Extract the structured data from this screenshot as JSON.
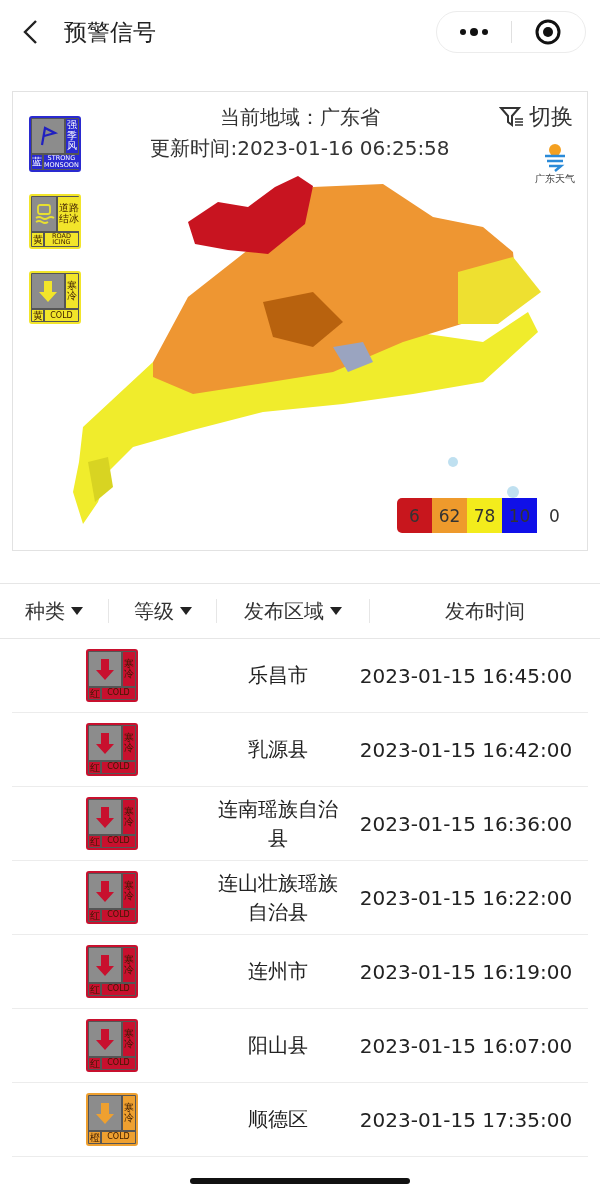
{
  "nav": {
    "title": "预警信号"
  },
  "card": {
    "region": "当前地域：广东省",
    "updated": "更新时间:2023-01-16 06:25:58",
    "switch": "切换",
    "logo": "广东天气",
    "signals": [
      {
        "kind": "monsoon",
        "title": "强季风",
        "level": "蓝",
        "english": "STRONG MONSOON",
        "color": "#2a2ad0"
      },
      {
        "kind": "icing",
        "title": "道路结冰",
        "level": "黄",
        "english": "ROAD ICING",
        "color": "#f2e52a"
      },
      {
        "kind": "cold",
        "title": "寒冷",
        "level": "黄",
        "english": "COLD",
        "color": "#f2e52a"
      }
    ],
    "legend": [
      {
        "count": "6",
        "color": "#c8161d"
      },
      {
        "count": "62",
        "color": "#ee9a2c"
      },
      {
        "count": "78",
        "color": "#f3ec1c"
      },
      {
        "count": "10",
        "color": "#1010e8"
      },
      {
        "count": "0",
        "color": "#ffffff"
      }
    ]
  },
  "table": {
    "columns": [
      {
        "label": "种类",
        "kind": "filter"
      },
      {
        "label": "等级",
        "kind": "filter"
      },
      {
        "label": "发布区域",
        "kind": "filter"
      },
      {
        "label": "发布时间",
        "kind": "plain"
      }
    ],
    "rows": [
      {
        "signal": {
          "kind": "cold",
          "title": "寒冷",
          "level": "红",
          "english": "COLD",
          "color": "#c8102e"
        },
        "area": "乐昌市",
        "time": "2023-01-15 16:45:00"
      },
      {
        "signal": {
          "kind": "cold",
          "title": "寒冷",
          "level": "红",
          "english": "COLD",
          "color": "#c8102e"
        },
        "area": "乳源县",
        "time": "2023-01-15 16:42:00"
      },
      {
        "signal": {
          "kind": "cold",
          "title": "寒冷",
          "level": "红",
          "english": "COLD",
          "color": "#c8102e"
        },
        "area": "连南瑶族自治县",
        "time": "2023-01-15 16:36:00"
      },
      {
        "signal": {
          "kind": "cold",
          "title": "寒冷",
          "level": "红",
          "english": "COLD",
          "color": "#c8102e"
        },
        "area": "连山壮族瑶族自治县",
        "time": "2023-01-15 16:22:00"
      },
      {
        "signal": {
          "kind": "cold",
          "title": "寒冷",
          "level": "红",
          "english": "COLD",
          "color": "#c8102e"
        },
        "area": "连州市",
        "time": "2023-01-15 16:19:00"
      },
      {
        "signal": {
          "kind": "cold",
          "title": "寒冷",
          "level": "红",
          "english": "COLD",
          "color": "#c8102e"
        },
        "area": "阳山县",
        "time": "2023-01-15 16:07:00"
      },
      {
        "signal": {
          "kind": "cold",
          "title": "寒冷",
          "level": "橙",
          "english": "COLD",
          "color": "#eea030"
        },
        "area": "顺德区",
        "time": "2023-01-15 17:35:00"
      }
    ]
  }
}
